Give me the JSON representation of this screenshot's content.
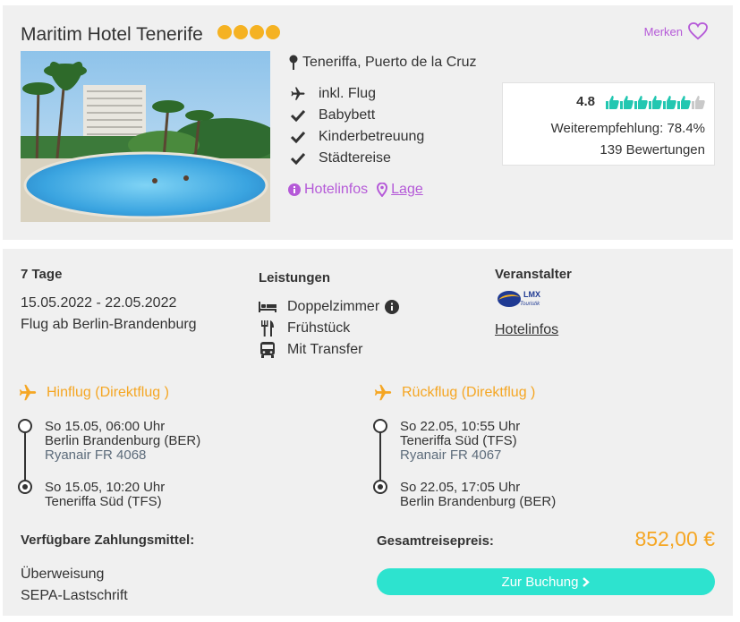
{
  "hotel": {
    "name": "Maritim Hotel Tenerife",
    "stars": 4,
    "star_color": "#f5b222",
    "merken_label": "Merken",
    "location": "Teneriffa, Puerto de la Cruz",
    "features": [
      {
        "icon": "plane-icon",
        "label": "inkl. Flug"
      },
      {
        "icon": "check-icon",
        "label": "Babybett"
      },
      {
        "icon": "check-icon",
        "label": "Kinderbetreuung"
      },
      {
        "icon": "check-icon",
        "label": "Städtereise"
      }
    ],
    "hotelinfos_label": "Hotelinfos",
    "lage_label": "Lage",
    "accent_color": "#b55ad8"
  },
  "rating": {
    "score": "4.8",
    "thumbs_filled": 6,
    "thumbs_total": 7,
    "recommendation": "Weiterempfehlung: 78.4%",
    "reviews": "139 Bewertungen"
  },
  "trip": {
    "duration": "7 Tage",
    "dates": "15.05.2022 - 22.05.2022",
    "departure": "Flug ab Berlin-Brandenburg"
  },
  "services": {
    "heading": "Leistungen",
    "items": [
      {
        "icon": "bed-icon",
        "label": "Doppelzimmer"
      },
      {
        "icon": "cutlery-icon",
        "label": "Frühstück"
      },
      {
        "icon": "bus-icon",
        "label": "Mit Transfer"
      }
    ]
  },
  "organizer": {
    "heading": "Veranstalter",
    "logo_text": "LMX Touristik",
    "link": "Hotelinfos"
  },
  "outbound": {
    "title": "Hinflug (Direktflug )",
    "dep_time": "So 15.05, 06:00 Uhr",
    "dep_airport": "Berlin Brandenburg (BER)",
    "carrier": "Ryanair FR 4068",
    "arr_time": "So 15.05, 10:20 Uhr",
    "arr_airport": "Teneriffa Süd (TFS)"
  },
  "return": {
    "title": "Rückflug (Direktflug )",
    "dep_time": "So 22.05, 10:55 Uhr",
    "dep_airport": "Teneriffa Süd (TFS)",
    "carrier": "Ryanair FR 4067",
    "arr_time": "So 22.05, 17:05 Uhr",
    "arr_airport": "Berlin Brandenburg (BER)"
  },
  "payment": {
    "heading": "Verfügbare Zahlungsmittel:",
    "methods": [
      "Überweisung",
      "SEPA-Lastschrift"
    ]
  },
  "price": {
    "label": "Gesamtreisepreis:",
    "value": "852,00 €",
    "color": "#f5a623"
  },
  "booking": {
    "button_label": "Zur Buchung",
    "button_color": "#2de3cf"
  }
}
